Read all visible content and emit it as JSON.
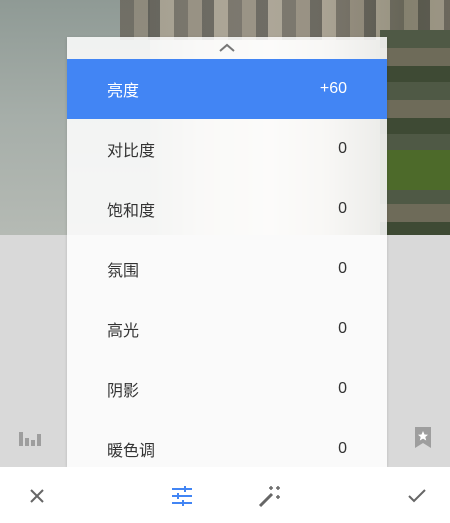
{
  "adjustments": [
    {
      "label": "亮度",
      "value": "+60",
      "active": true
    },
    {
      "label": "对比度",
      "value": "0",
      "active": false
    },
    {
      "label": "饱和度",
      "value": "0",
      "active": false
    },
    {
      "label": "氛围",
      "value": "0",
      "active": false
    },
    {
      "label": "高光",
      "value": "0",
      "active": false
    },
    {
      "label": "阴影",
      "value": "0",
      "active": false
    },
    {
      "label": "暖色调",
      "value": "0",
      "active": false
    }
  ],
  "icons": {
    "panel_handle": "chevron-up-icon",
    "left_side": "histogram-icon",
    "right_side": "bookmark-star-icon",
    "cancel": "close-icon",
    "tune": "tune-sliders-icon",
    "auto": "magic-wand-icon",
    "apply": "checkmark-icon"
  },
  "colors": {
    "accent": "#4285f4",
    "icon_gray": "#666666",
    "side_icon_gray": "#9e9e9e"
  }
}
